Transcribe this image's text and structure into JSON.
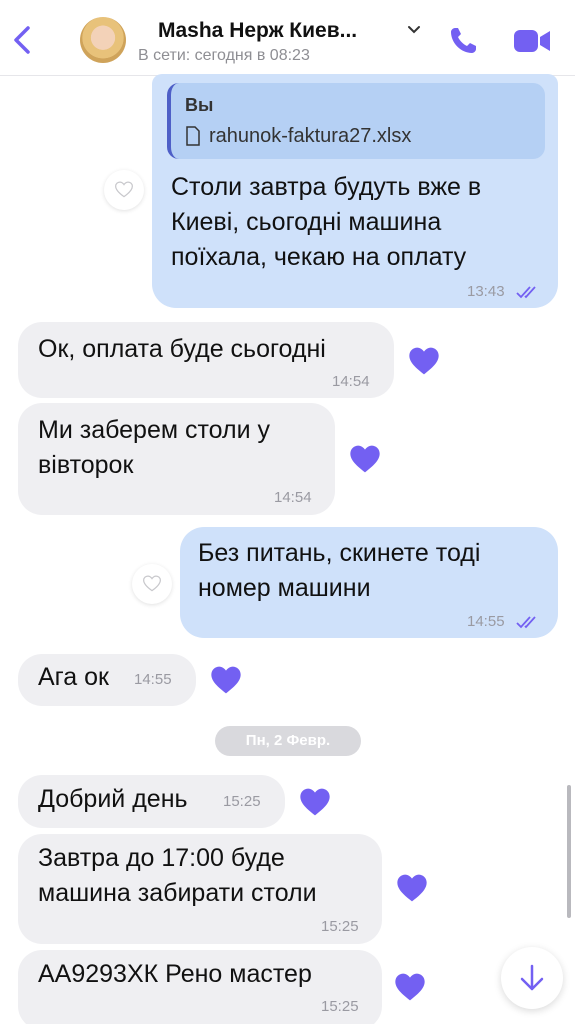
{
  "header": {
    "contact_name": "Masha Нерж Киев...",
    "status": "В сети: сегодня в 08:23"
  },
  "colors": {
    "accent": "#7360f2",
    "outgoing_bubble": "#cfe1fa",
    "incoming_bubble": "#efeff2"
  },
  "messages": [
    {
      "direction": "out",
      "reply_to": {
        "author": "Вы",
        "file": "rahunok-faktura27.xlsx"
      },
      "lines": [
        "Столи завтра будуть вже в",
        "Киеві, сьогодні машина",
        "поїхала, чекаю на оплату"
      ],
      "time": "13:43"
    },
    {
      "direction": "in",
      "lines": [
        "Ок, оплата буде сьогодні"
      ],
      "time": "14:54"
    },
    {
      "direction": "in",
      "lines": [
        "Ми заберем столи у",
        "вівторок"
      ],
      "time": "14:54"
    },
    {
      "direction": "out",
      "lines": [
        "Без питань, скинете тоді",
        "номер машини"
      ],
      "time": "14:55"
    },
    {
      "direction": "in",
      "lines": [
        "Ага ок"
      ],
      "time": "14:55"
    },
    {
      "direction": "in",
      "lines": [
        "Добрий день"
      ],
      "time": "15:25"
    },
    {
      "direction": "in",
      "lines": [
        "Завтра до 17:00 буде",
        "машина забирати столи"
      ],
      "time": "15:25"
    },
    {
      "direction": "in",
      "lines": [
        "АА9293ХК Рено мастер"
      ],
      "time": "15:25"
    }
  ],
  "date_separator": "Пн, 2 Февр."
}
